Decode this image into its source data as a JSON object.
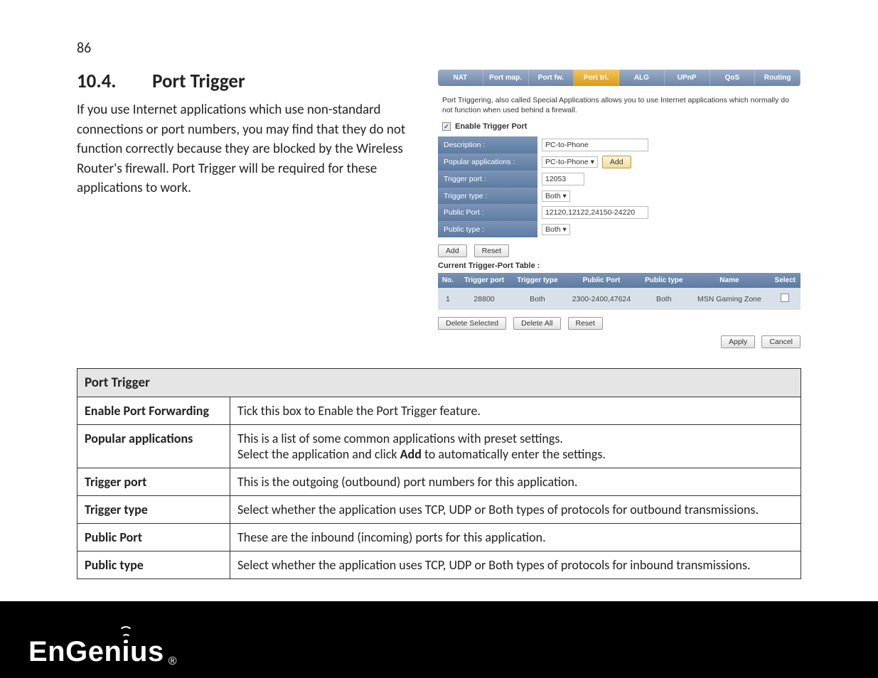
{
  "page": {
    "number": "86"
  },
  "section": {
    "num": "10.4.",
    "title": "Port Trigger"
  },
  "intro_para": "If you use Internet applications which use non-standard connections or port numbers, you may find that they do not function correctly because they are blocked by the Wireless Router's firewall. Port Trigger will be required for these applications to work.",
  "router": {
    "tabs": [
      "NAT",
      "Port map.",
      "Port fw.",
      "Port tri.",
      "ALG",
      "UPnP",
      "QoS",
      "Routing"
    ],
    "active_tab_index": 3,
    "intro": "Port Triggering, also called Special Applications allows you to use Internet applications which normally do not function when used behind a firewall.",
    "enable_label": "Enable Trigger Port",
    "fields": {
      "description_label": "Description :",
      "description_value": "PC-to-Phone",
      "popular_label": "Popular applications :",
      "popular_value": "PC-to-Phone",
      "popular_add": "Add",
      "trigger_port_label": "Trigger port :",
      "trigger_port_value": "12053",
      "trigger_type_label": "Trigger type :",
      "trigger_type_value": "Both",
      "public_port_label": "Public Port :",
      "public_port_value": "12120,12122,24150-24220",
      "public_type_label": "Public type :",
      "public_type_value": "Both"
    },
    "buttons": {
      "add": "Add",
      "reset": "Reset",
      "delete_selected": "Delete Selected",
      "delete_all": "Delete All",
      "apply": "Apply",
      "cancel": "Cancel"
    },
    "table_title": "Current Trigger-Port Table :",
    "table_headers": [
      "No.",
      "Trigger port",
      "Trigger type",
      "Public Port",
      "Public type",
      "Name",
      "Select"
    ],
    "table_row": {
      "no": "1",
      "trigger_port": "28800",
      "trigger_type": "Both",
      "public_port": "2300-2400,47624",
      "public_type": "Both",
      "name": "MSN Gaming Zone"
    }
  },
  "desc_table": {
    "title": "Port Trigger",
    "rows": [
      {
        "k": "Enable Port Forwarding",
        "v": "Tick this box to Enable the Port Trigger feature."
      },
      {
        "k": "Popular applications",
        "v_pre": "This is a list of some common applications with preset settings.\nSelect the application and click ",
        "v_bold": "Add",
        "v_post": " to automatically enter the settings."
      },
      {
        "k": "Trigger port",
        "v": "This is the outgoing (outbound) port numbers for this application."
      },
      {
        "k": "Trigger type",
        "v": "Select whether the application uses TCP, UDP or Both types of protocols for outbound transmissions."
      },
      {
        "k": "Public Port",
        "v": "These are the inbound (incoming) ports for this application."
      },
      {
        "k": "Public type",
        "v": "Select whether the application uses TCP, UDP or Both types of protocols for inbound transmissions."
      }
    ]
  },
  "logo": {
    "text_left": "EnGen",
    "text_i": "i",
    "text_right": "us",
    "reg": "®"
  }
}
